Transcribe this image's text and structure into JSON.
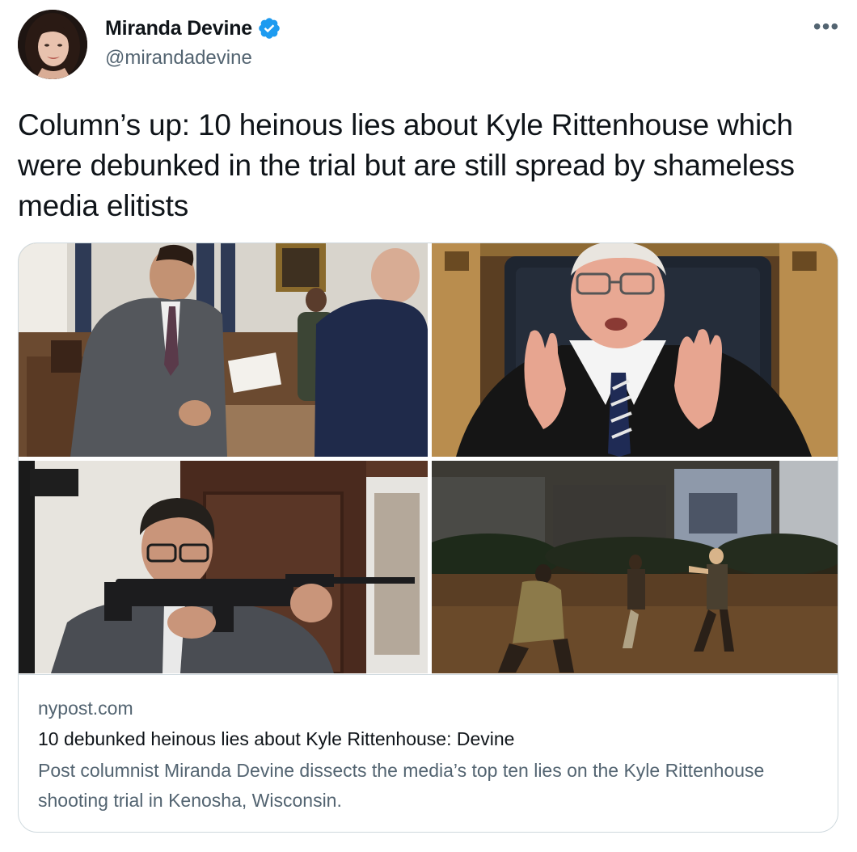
{
  "author": {
    "display_name": "Miranda Devine",
    "handle": "@mirandadevine",
    "verified": true,
    "avatar_icon": "profile-photo"
  },
  "menu": {
    "more_icon": "more-horizontal-icon",
    "more_glyph": "•••"
  },
  "tweet": {
    "text": "Column’s up: 10 heinous lies about Kyle Rittenhouse which were debunked in the trial but are still spread by shameless media elitists"
  },
  "card": {
    "domain": "nypost.com",
    "title": "10 debunked heinous lies about Kyle Rittenhouse: Devine",
    "description": "Post columnist Miranda Devine dissects the media’s top ten lies on the Kyle Rittenhouse shooting trial in Kenosha, Wisconsin.",
    "images": [
      "courtroom-defendant-photo",
      "judge-photo",
      "prosecutor-with-rifle-photo",
      "night-street-video-still"
    ]
  },
  "colors": {
    "text_primary": "#0f1419",
    "text_secondary": "#536471",
    "verified_blue": "#1d9bf0",
    "border": "#cfd9de"
  }
}
